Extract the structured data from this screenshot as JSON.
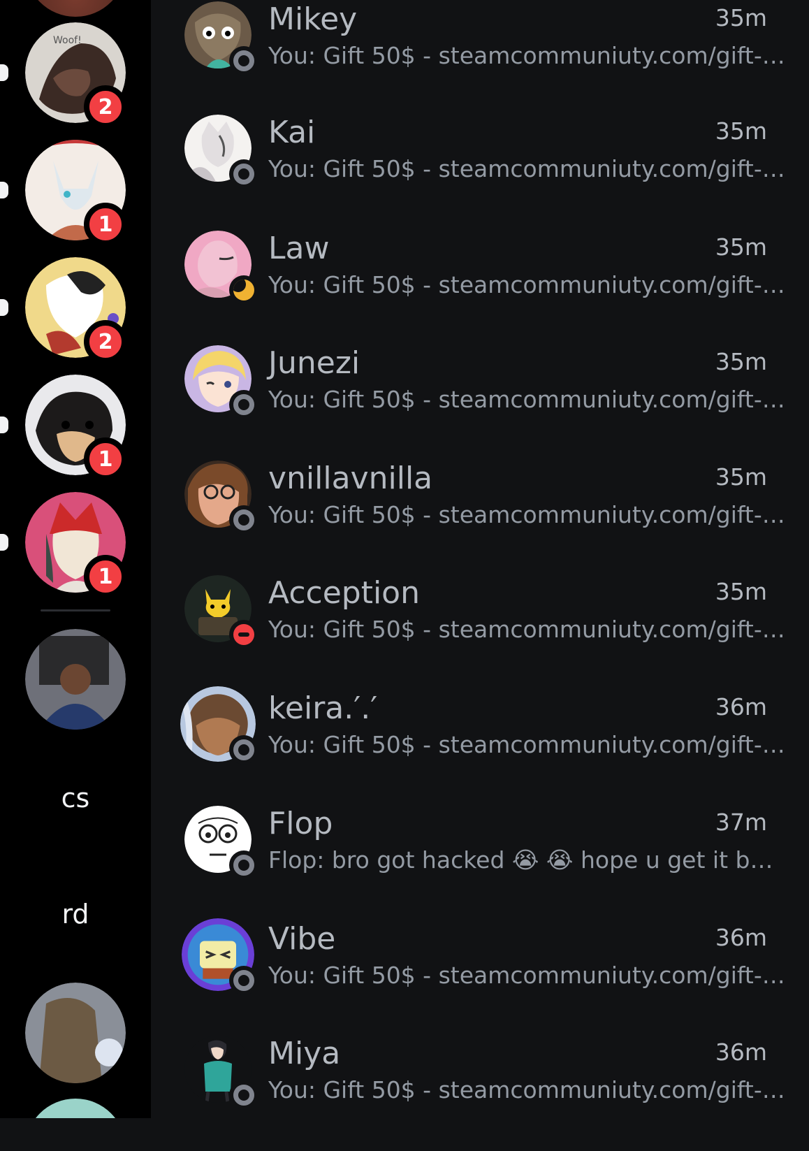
{
  "server_rail": {
    "badges": [
      "2",
      "1",
      "2",
      "1",
      "1"
    ],
    "text_items": [
      "cs",
      "rd"
    ]
  },
  "colors": {
    "background": "#111214",
    "rail_background": "#000000",
    "badge": "#f23f43",
    "idle": "#f0b232",
    "dnd": "#f23f43",
    "offline": "#80848e"
  },
  "dms": [
    {
      "name": "Mikey",
      "time": "35m",
      "preview": "You: Gift 50$ - steamcommuniuty.com/gift-ca...",
      "status": "offline",
      "avatar_icon": "furry-avatar-icon"
    },
    {
      "name": "Kai",
      "time": "35m",
      "preview": "You: Gift 50$ - steamcommuniuty.com/gift-ca...",
      "status": "offline",
      "avatar_icon": "white-cat-avatar-icon"
    },
    {
      "name": "Law",
      "time": "35m",
      "preview": "You: Gift 50$ - steamcommuniuty.com/gift-ca...",
      "status": "idle",
      "avatar_icon": "pink-furry-avatar-icon"
    },
    {
      "name": "Junezi",
      "time": "35m",
      "preview": "You: Gift 50$ - steamcommuniuty.com/gift-ca...",
      "status": "offline",
      "avatar_icon": "anime-blonde-avatar-icon"
    },
    {
      "name": "vnillavnilla",
      "time": "35m",
      "preview": "You: Gift 50$ - steamcommuniuty.com/gift-ca...",
      "status": "offline",
      "avatar_icon": "photo-avatar-icon"
    },
    {
      "name": "Acception",
      "time": "35m",
      "preview": "You: Gift 50$ - steamcommuniuty.com/gift-ca...",
      "status": "dnd",
      "avatar_icon": "pikachu-avatar-icon"
    },
    {
      "name": "keira.′.′",
      "time": "36m",
      "preview": "You: Gift 50$ - steamcommuniuty.com/gift-ca...",
      "status": "offline",
      "avatar_icon": "decorated-avatar-icon"
    },
    {
      "name": "Flop",
      "time": "37m",
      "preview": "Flop: bro got hacked 😭 😭 hope u get it back...",
      "status": "offline",
      "avatar_icon": "meme-face-avatar-icon"
    },
    {
      "name": "Vibe",
      "time": "36m",
      "preview": "You: Gift 50$ - steamcommuniuty.com/gift-ca...",
      "status": "offline",
      "avatar_icon": "cartoon-avatar-icon"
    },
    {
      "name": "Miya",
      "time": "36m",
      "preview": "You: Gift 50$ - steamcommuniuty.com/gift-ca...",
      "status": "offline",
      "avatar_icon": "anime-girl-avatar-icon"
    }
  ]
}
